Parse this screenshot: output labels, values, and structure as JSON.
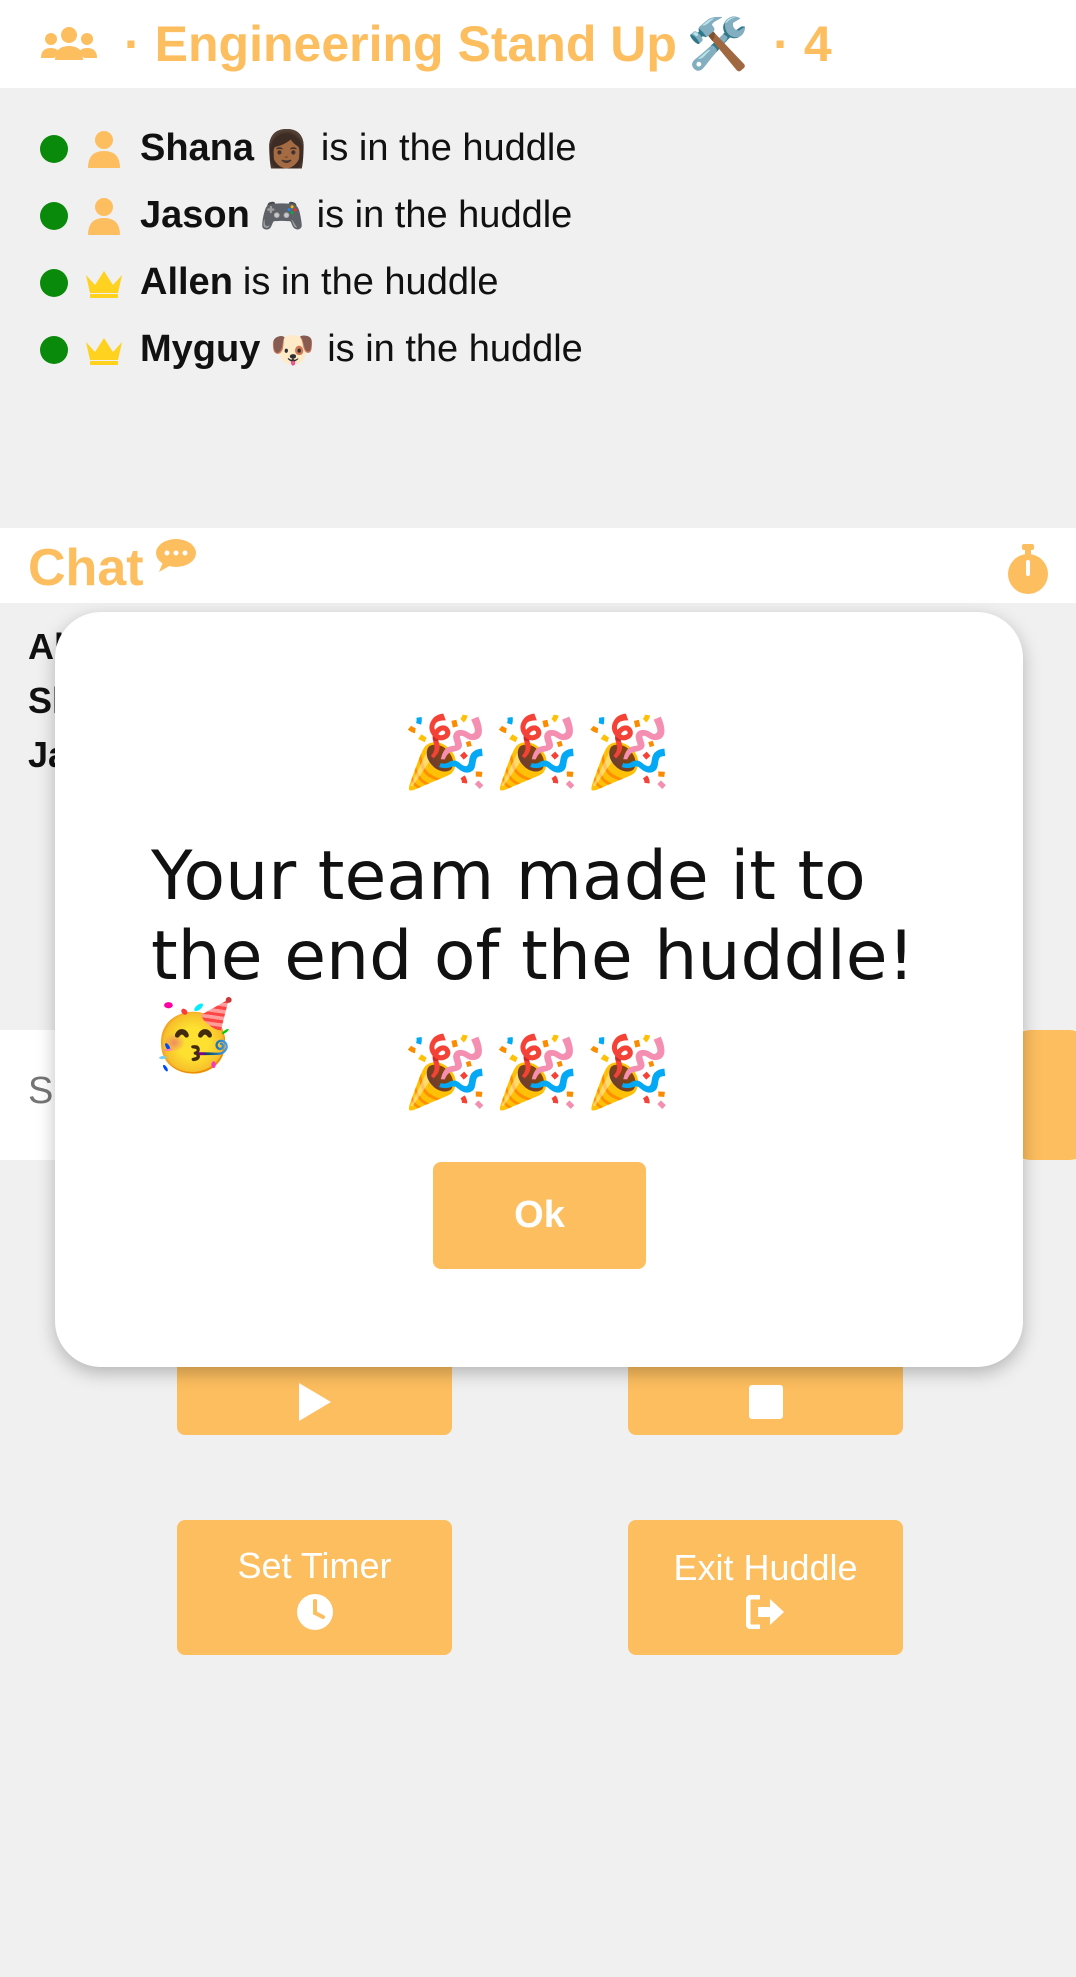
{
  "header": {
    "title": "Engineering Stand Up",
    "title_emoji": "🛠️",
    "count": "4",
    "separator": "·",
    "icon": "people-group-icon"
  },
  "members": [
    {
      "name": "Shana",
      "emoji": "👩🏾",
      "status": "is in the huddle",
      "role_icon": "person-icon"
    },
    {
      "name": "Jason",
      "emoji": "🎮",
      "status": "is in the huddle",
      "role_icon": "person-icon"
    },
    {
      "name": "Allen",
      "emoji": "",
      "status": "is in the huddle",
      "role_icon": "crown-icon"
    },
    {
      "name": "Myguy",
      "emoji": "🐶",
      "status": "is in the huddle",
      "role_icon": "crown-icon"
    }
  ],
  "chat": {
    "title": "Chat",
    "visible_lines": [
      "Al",
      "Sh",
      "Ja"
    ],
    "input_placeholder": "Se"
  },
  "controls": {
    "set_timer_label": "Set Timer",
    "exit_huddle_label": "Exit Huddle"
  },
  "modal": {
    "party_top": "🎉🎉🎉",
    "message": "Your team made it to the end of the huddle! 🥳",
    "party_bottom": "🎉🎉🎉",
    "ok_label": "Ok"
  },
  "colors": {
    "accent": "#fdbe5f",
    "online": "#0a8a0a",
    "crown": "#ffd21f",
    "background": "#f0f0f0"
  }
}
